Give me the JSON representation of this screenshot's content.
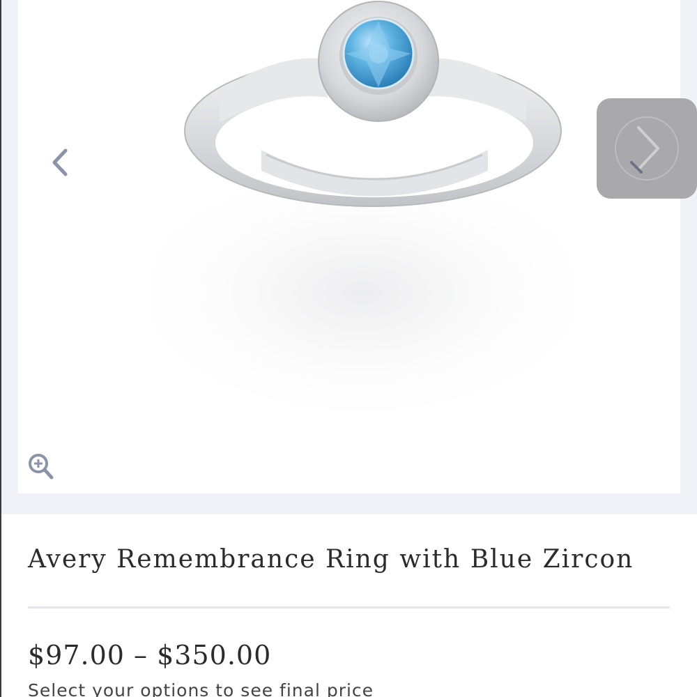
{
  "product": {
    "title": "Avery Remembrance Ring with Blue Zircon",
    "price_range": "$97.00 – $350.00",
    "price_note": "Select your options to see final price"
  },
  "gallery": {
    "prev_icon": "chevron-left-icon",
    "next_icon": "chevron-right-icon",
    "zoom_icon": "zoom-in-icon"
  },
  "colors": {
    "gallery_background": "#f1f2f7",
    "arrow": "#8b93a8",
    "next_button": "#a9a9ab",
    "gemstone": "#4aa3d6",
    "text": "#2b2b2b"
  }
}
